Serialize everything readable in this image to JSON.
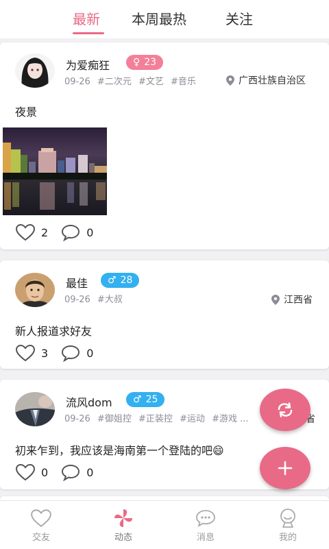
{
  "tabs": [
    {
      "label": "最新",
      "active": true
    },
    {
      "label": "本周最热",
      "active": false
    },
    {
      "label": "关注",
      "active": false
    }
  ],
  "posts": [
    {
      "name": "为爱痴狂",
      "gender": "female",
      "age": "23",
      "date": "09-26",
      "tags": [
        "#二次元",
        "#文艺",
        "#音乐"
      ],
      "location": "广西壮族自治区",
      "content": "夜景",
      "likes": "2",
      "comments": "0"
    },
    {
      "name": "最佳",
      "gender": "male",
      "age": "28",
      "date": "09-26",
      "tags": [
        "#大叔"
      ],
      "location": "江西省",
      "content": "新人报道求好友",
      "likes": "3",
      "comments": "0"
    },
    {
      "name": "流风dom",
      "gender": "male",
      "age": "25",
      "date": "09-26",
      "tags": [
        "#御姐控",
        "#正装控",
        "#运动",
        "#游戏 ..."
      ],
      "location": "省",
      "content": "初来乍到，我应该是海南第一个登陆的吧😄",
      "likes": "0",
      "comments": "0"
    }
  ],
  "gender_symbols": {
    "female": "♀",
    "male": "♂"
  },
  "colors": {
    "accent": "#e96a86",
    "female_badge": "#f47f98",
    "male_badge": "#33b0ef"
  },
  "nav": [
    {
      "label": "交友",
      "icon": "heart-icon"
    },
    {
      "label": "动态",
      "icon": "pinwheel-icon",
      "active": true
    },
    {
      "label": "消息",
      "icon": "chat-icon"
    },
    {
      "label": "我的",
      "icon": "profile-icon"
    }
  ]
}
